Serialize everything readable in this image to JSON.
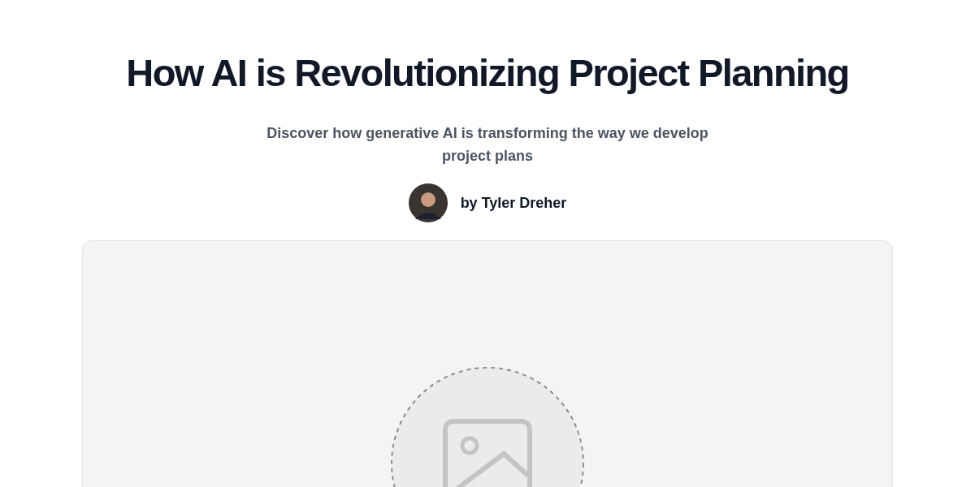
{
  "article": {
    "title": "How AI is Revolutionizing Project Planning",
    "subtitle": "Discover how generative AI is transforming the way we develop project plans",
    "author": {
      "byline": "by Tyler Dreher"
    }
  }
}
